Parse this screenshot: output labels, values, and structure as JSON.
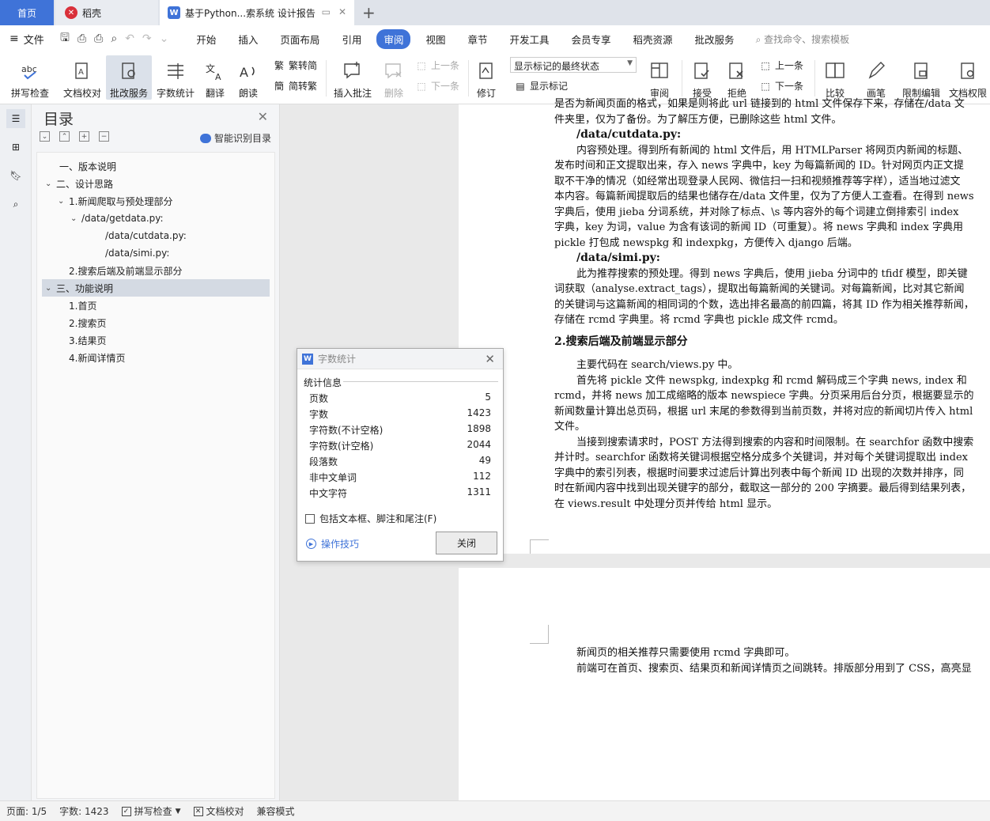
{
  "tabs": {
    "home": "首页",
    "daoke": "稻壳",
    "doc": "基于Python...索系统 设计报告"
  },
  "menu": {
    "file": "文件",
    "items": [
      "开始",
      "插入",
      "页面布局",
      "引用",
      "审阅",
      "视图",
      "章节",
      "开发工具",
      "会员专享",
      "稻壳资源",
      "批改服务"
    ],
    "active": "审阅",
    "search": "查找命令、搜索模板"
  },
  "ribbon": {
    "spell": "拼写检查",
    "proof": "文档校对",
    "correct": "批改服务",
    "wordcount": "字数统计",
    "translate": "翻译",
    "read": "朗读",
    "t2s": "繁转简",
    "s2t": "简转繁",
    "insert_comment": "插入批注",
    "delete": "删除",
    "prev": "上一条",
    "next": "下一条",
    "revise": "修订",
    "markup_select": "显示标记的最终状态",
    "show_markup": "显示标记",
    "review": "审阅",
    "accept": "接受",
    "reject": "拒绝",
    "prev2": "上一条",
    "next2": "下一条",
    "compare": "比较",
    "ink": "画笔",
    "restrict": "限制编辑",
    "protect": "文档权限"
  },
  "toc": {
    "title": "目录",
    "smart": "智能识别目录",
    "items": [
      "一、版本说明",
      "二、设计思路",
      "1.新闻爬取与预处理部分",
      "/data/getdata.py:",
      "/data/cutdata.py:",
      "/data/simi.py:",
      "2.搜索后端及前端显示部分",
      "三、功能说明",
      "1.首页",
      "2.搜索页",
      "3.结果页",
      "4.新闻详情页"
    ]
  },
  "doc": {
    "page1": [
      "是否为新闻页面的格式，如果是则将此 url 链接到的 html 文件保存下来，存储在/data 文",
      "件夹里，仅为了备份。为了解压方便，已删除这些 html 文件。",
      "/data/cutdata.py:",
      "内容预处理。得到所有新闻的 html 文件后，用 HTMLParser 将网页内新闻的标题、",
      "发布时间和正文提取出来，存入 news 字典中，key 为每篇新闻的 ID。针对网页内正文提",
      "取不干净的情况（如经常出现登录人民网、微信扫一扫和视频推荐等字样），适当地过滤文",
      "本内容。每篇新闻提取后的结果也储存在/data 文件里，仅为了方便人工查看。在得到 news",
      "字典后，使用 jieba 分词系统，并对除了标点、\\s 等内容外的每个词建立倒排索引 index",
      "字典，key 为词，value 为含有该词的新闻 ID（可重复）。将 news 字典和 index 字典用",
      "pickle 打包成 newspkg 和 indexpkg，方便传入 django 后端。",
      "/data/simi.py:",
      "此为推荐搜索的预处理。得到 news 字典后，使用 jieba 分词中的 tfidf 模型，即关键",
      "词获取（analyse.extract_tags），提取出每篇新闻的关键词。对每篇新闻，比对其它新闻",
      "的关键词与这篇新闻的相同词的个数，选出排名最高的前四篇，将其 ID 作为相关推荐新闻，",
      "存储在 rcmd 字典里。将 rcmd 字典也 pickle 成文件 rcmd。",
      "2.搜索后端及前端显示部分",
      "主要代码在 search/views.py 中。",
      "首先将 pickle 文件 newspkg, indexpkg 和 rcmd 解码成三个字典 news, index 和",
      "rcmd，并将 news 加工成缩略的版本 newspiece 字典。分页采用后台分页，根据要显示的",
      "新闻数量计算出总页码，根据 url 末尾的参数得到当前页数，并将对应的新闻切片传入 html",
      "文件。",
      "当接到搜索请求时，POST 方法得到搜索的内容和时间限制。在 searchfor 函数中搜索",
      "并计时。searchfor 函数将关键词根据空格分成多个关键词，并对每个关键词提取出 index",
      "字典中的索引列表，根据时间要求过滤后计算出列表中每个新闻 ID 出现的次数并排序，同",
      "时在新闻内容中找到出现关键字的部分，截取这一部分的 200 字摘要。最后得到结果列表，",
      "在 views.result 中处理分页并传给 html 显示。"
    ],
    "page2": [
      "新闻页的相关推荐只需要使用 rcmd 字典即可。",
      "前端可在首页、搜索页、结果页和新闻详情页之间跳转。排版部分用到了 CSS，高亮显"
    ]
  },
  "dialog": {
    "title": "字数统计",
    "section": "统计信息",
    "stats": [
      {
        "label": "页数",
        "value": "5"
      },
      {
        "label": "字数",
        "value": "1423"
      },
      {
        "label": "字符数(不计空格)",
        "value": "1898"
      },
      {
        "label": "字符数(计空格)",
        "value": "2044"
      },
      {
        "label": "段落数",
        "value": "49"
      },
      {
        "label": "非中文单词",
        "value": "112"
      },
      {
        "label": "中文字符",
        "value": "1311"
      }
    ],
    "include": "包括文本框、脚注和尾注(F)",
    "tips": "操作技巧",
    "close": "关闭"
  },
  "status": {
    "page": "页面: 1/5",
    "words": "字数: 1423",
    "spell": "拼写检查",
    "proof": "文档校对",
    "compat": "兼容模式"
  },
  "colors": {
    "accent": "#3f73d8",
    "wps_red": "#d9303a"
  }
}
